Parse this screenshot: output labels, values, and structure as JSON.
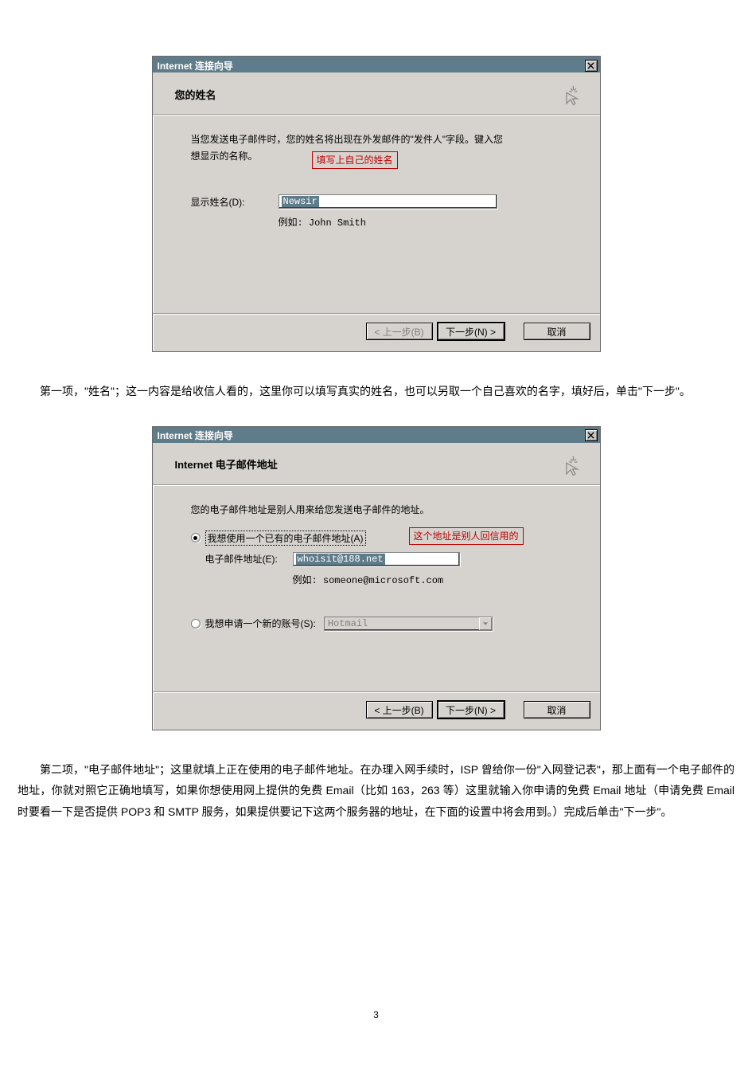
{
  "wizard1": {
    "title": "Internet 连接向导",
    "header": "您的姓名",
    "intro1": "当您发送电子邮件时，您的姓名将出现在外发邮件的\"发件人\"字段。键入您",
    "intro2": "想显示的名称。",
    "hint": "填写上自己的姓名",
    "label_display_name": "显示姓名(D):",
    "input_value": "Newsir",
    "example": "例如: John Smith",
    "btn_back": "< 上一步(B)",
    "btn_next": "下一步(N) >",
    "btn_cancel": "取消"
  },
  "para1": "第一项，\"姓名\"；这一内容是给收信人看的，这里你可以填写真实的姓名，也可以另取一个自己喜欢的名字，填好后，单击\"下一步\"。",
  "wizard2": {
    "title": "Internet 连接向导",
    "header": "Internet 电子邮件地址",
    "intro1": "您的电子邮件地址是别人用来给您发送电子邮件的地址。",
    "radio_existing": "我想使用一个已有的电子邮件地址(A)",
    "hint": "这个地址是别人回信用的",
    "label_email": "电子邮件地址(E):",
    "input_value": "whoisit@188.net",
    "example": "例如: someone@microsoft.com",
    "radio_new": "我想申请一个新的账号(S):",
    "dropdown_value": "Hotmail",
    "btn_back": "< 上一步(B)",
    "btn_next": "下一步(N) >",
    "btn_cancel": "取消"
  },
  "para2": "第二项，\"电子邮件地址\"；这里就填上正在使用的电子邮件地址。在办理入网手续时，ISP 曾给你一份\"入网登记表\"，那上面有一个电子邮件的地址，你就对照它正确地填写，如果你想使用网上提供的免费 Email（比如 163，263 等）这里就输入你申请的免费 Email 地址（申请免费 Email 时要看一下是否提供 POP3 和 SMTP 服务，如果提供要记下这两个服务器的地址，在下面的设置中将会用到。）完成后单击\"下一步\"。",
  "page_number": "3"
}
